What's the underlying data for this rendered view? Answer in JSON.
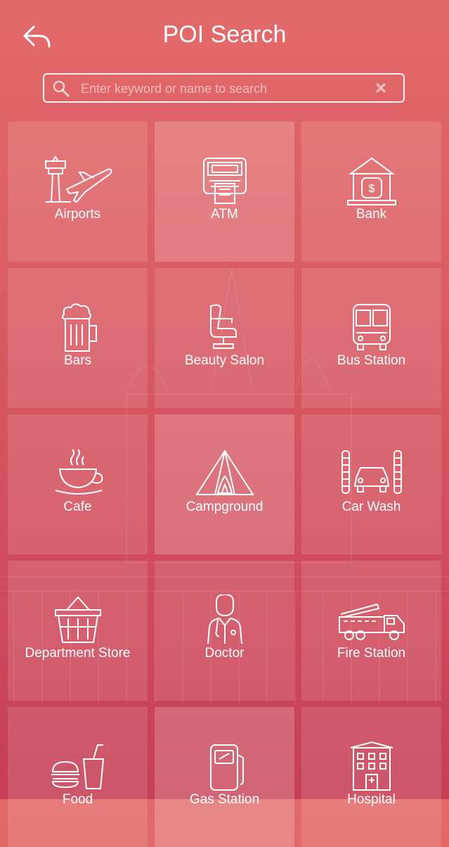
{
  "header": {
    "title": "POI Search",
    "back_icon": "back-arrow-icon"
  },
  "search": {
    "placeholder": "Enter keyword or name to search",
    "value": ""
  },
  "categories": [
    {
      "label": "Airports",
      "icon": "airport-icon"
    },
    {
      "label": "ATM",
      "icon": "atm-icon"
    },
    {
      "label": "Bank",
      "icon": "bank-icon"
    },
    {
      "label": "Bars",
      "icon": "beer-mug-icon"
    },
    {
      "label": "Beauty Salon",
      "icon": "salon-chair-icon"
    },
    {
      "label": "Bus Station",
      "icon": "bus-icon"
    },
    {
      "label": "Cafe",
      "icon": "coffee-cup-icon"
    },
    {
      "label": "Campground",
      "icon": "tent-icon"
    },
    {
      "label": "Car Wash",
      "icon": "car-wash-icon"
    },
    {
      "label": "Department Store",
      "icon": "shopping-basket-icon"
    },
    {
      "label": "Doctor",
      "icon": "doctor-icon"
    },
    {
      "label": "Fire Station",
      "icon": "fire-truck-icon"
    },
    {
      "label": "Food",
      "icon": "burger-drink-icon"
    },
    {
      "label": "Gas Station",
      "icon": "gas-pump-icon"
    },
    {
      "label": "Hospital",
      "icon": "hospital-icon"
    }
  ],
  "colors": {
    "background_top": "#e36a6a",
    "background_bottom": "#c63f56",
    "foreground": "#ffffff"
  }
}
